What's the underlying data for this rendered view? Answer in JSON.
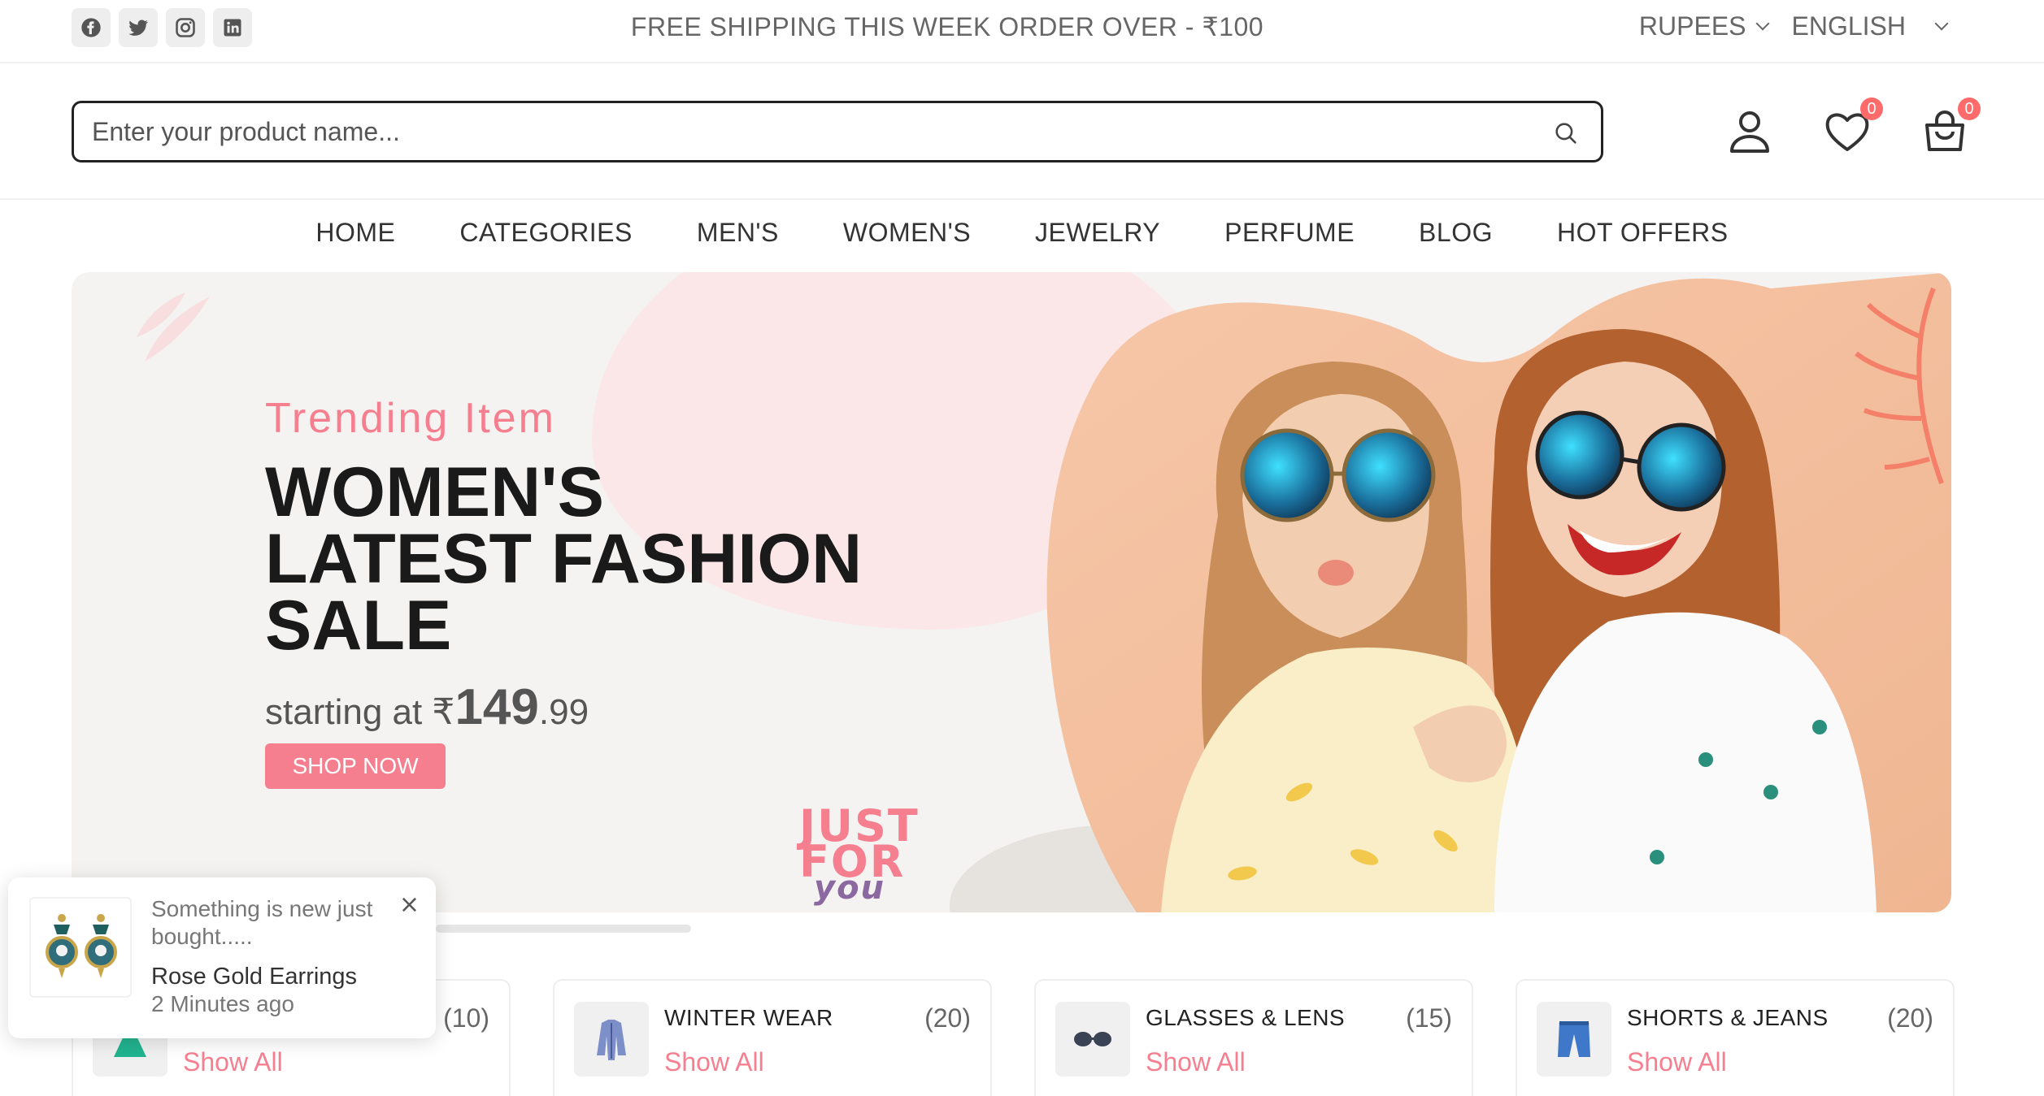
{
  "topbar": {
    "socials": [
      {
        "name": "facebook-icon",
        "glyph": "f"
      },
      {
        "name": "twitter-icon",
        "glyph": "t"
      },
      {
        "name": "instagram-icon",
        "glyph": "i"
      },
      {
        "name": "linkedin-icon",
        "glyph": "in"
      }
    ],
    "announcement": "FREE SHIPPING THIS WEEK ORDER OVER - ₹100",
    "currency": "RUPEES",
    "language": "ENGLISH"
  },
  "header": {
    "search_placeholder": "Enter your product name...",
    "wishlist_count": "0",
    "cart_count": "0"
  },
  "nav": {
    "items": [
      "HOME",
      "CATEGORIES",
      "MEN'S",
      "WOMEN'S",
      "JEWELRY",
      "PERFUME",
      "BLOG",
      "HOT OFFERS"
    ]
  },
  "hero": {
    "subtitle": "Trending Item",
    "title_line1": "WOMEN'S",
    "title_line2": "LATEST FASHION",
    "title_line3": "SALE",
    "price_prefix": "starting at ₹",
    "price_big": "149",
    "price_small": ".99",
    "cta": "SHOP NOW",
    "badge_line1": "JUST",
    "badge_line2": "FOR",
    "badge_line3": "you"
  },
  "categories": [
    {
      "name": "",
      "count": "(10)",
      "link": "Show All",
      "icon": "dress-icon"
    },
    {
      "name": "WINTER WEAR",
      "count": "(20)",
      "link": "Show All",
      "icon": "jacket-icon"
    },
    {
      "name": "GLASSES & LENS",
      "count": "(15)",
      "link": "Show All",
      "icon": "glasses-icon"
    },
    {
      "name": "SHORTS & JEANS",
      "count": "(20)",
      "link": "Show All",
      "icon": "shorts-icon"
    }
  ],
  "toast": {
    "message": "Something is new just bought.....",
    "product": "Rose Gold Earrings",
    "time": "2 Minutes ago",
    "close": "×"
  },
  "colors": {
    "accent": "#f67f8f",
    "badge": "#ff6b6b",
    "text": "#333333",
    "hero_bg": "#f4f3f1"
  }
}
